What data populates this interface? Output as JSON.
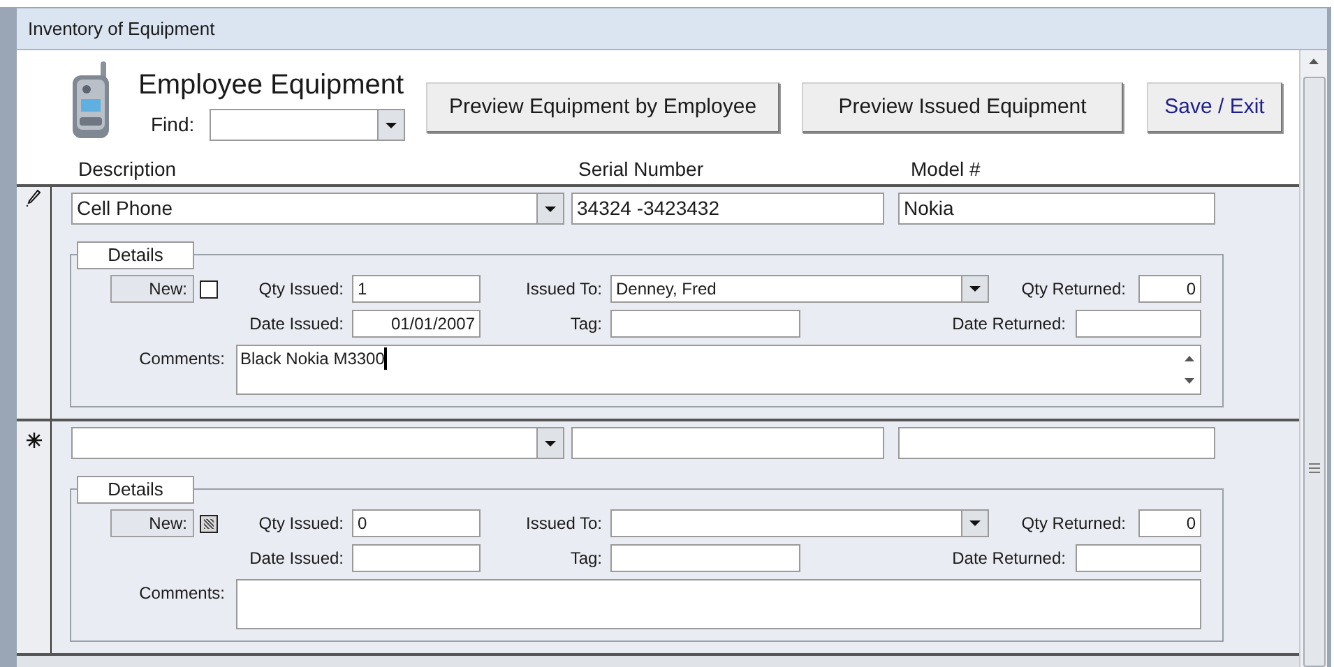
{
  "window": {
    "title": "Inventory of Equipment"
  },
  "header": {
    "title": "Employee Equipment",
    "find_label": "Find:"
  },
  "buttons": [
    {
      "label": "Preview Equipment by Employee",
      "kind": "normal"
    },
    {
      "label": "Preview Issued Equipment",
      "kind": "normal"
    },
    {
      "label": "Save / Exit",
      "kind": "accent"
    }
  ],
  "columns": [
    "Description",
    "Serial Number",
    "Model #"
  ],
  "records": [
    {
      "new_record": false,
      "description": "Cell Phone",
      "serial_number": "34324 -3423432",
      "model": "Nokia",
      "details": {
        "tab": "Details",
        "new_label": "New:",
        "new_checked": false,
        "new_null": false,
        "qty_issued_label": "Qty Issued:",
        "qty_issued": "1",
        "issued_to_label": "Issued To:",
        "issued_to": "Denney, Fred",
        "qty_returned_label": "Qty Returned:",
        "qty_returned": "0",
        "date_issued_label": "Date Issued:",
        "date_issued": "01/01/2007",
        "tag_label": "Tag:",
        "date_returned_label": "Date Returned:",
        "comments_label": "Comments:",
        "comments": "Black Nokia M3300",
        "comments_focused": true
      }
    },
    {
      "new_record": true,
      "details": {
        "tab": "Details",
        "new_label": "New:",
        "new_null": true,
        "qty_issued_label": "Qty Issued:",
        "qty_issued": "0",
        "issued_to_label": "Issued To:",
        "qty_returned_label": "Qty Returned:",
        "qty_returned": "0",
        "date_issued_label": "Date Issued:",
        "tag_label": "Tag:",
        "date_returned_label": "Date Returned:",
        "comments_label": "Comments:",
        "comments_focused": false
      }
    }
  ]
}
